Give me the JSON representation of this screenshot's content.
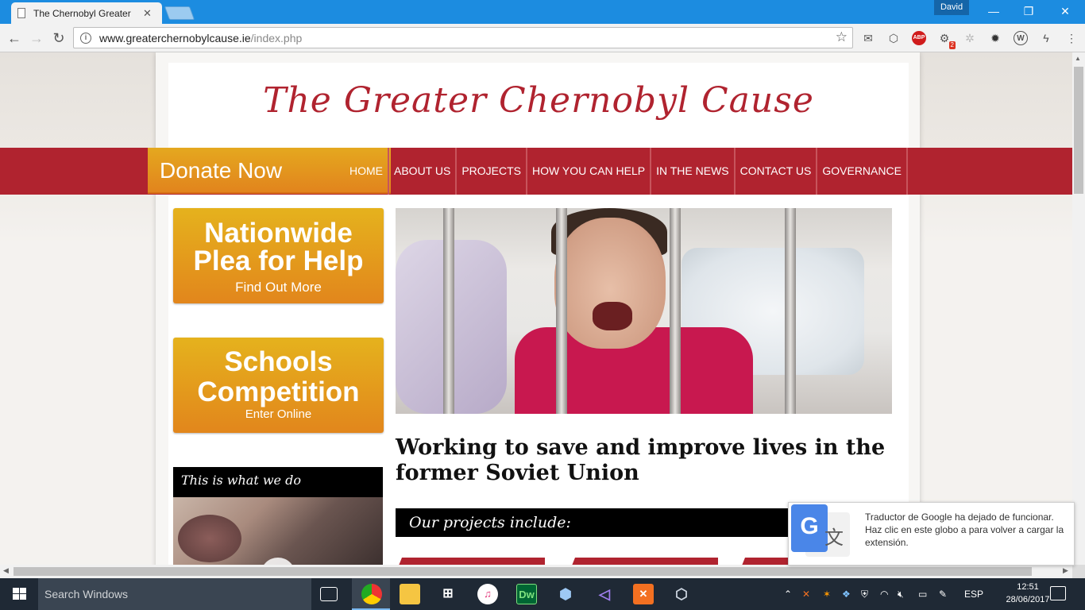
{
  "browser": {
    "tab_title": "The Chernobyl Greater C",
    "tab_close": "✕",
    "user": "David",
    "url_host": "www.greaterchernobylcause.ie",
    "url_path": "/index.php",
    "win_minimize": "—",
    "win_restore": "❐",
    "win_close": "✕",
    "extensions": [
      "mail-icon",
      "box-icon",
      "abp-icon",
      "puzzle-icon",
      "gear-icon",
      "settings-icon",
      "w-icon",
      "bolt-icon",
      "menu-icon"
    ],
    "abp_label": "ABP",
    "ext_badge": "2",
    "w_label": "W"
  },
  "site": {
    "title": "The Greater Chernobyl Cause",
    "donate": "Donate Now",
    "nav": [
      "HOME",
      "ABOUT US",
      "PROJECTS",
      "HOW YOU CAN HELP",
      "IN THE NEWS",
      "CONTACT US",
      "GOVERNANCE"
    ],
    "promo1": {
      "title": "Nationwide Plea for Help",
      "sub": "Find Out More"
    },
    "promo2": {
      "title": "Schools Competition",
      "sub": "Enter Online"
    },
    "video_title": "This is what we do",
    "tagline": "Working to save and improve lives in the former Soviet Union",
    "projects_heading": "Our projects include:"
  },
  "notification": {
    "message": "Traductor de Google ha dejado de funcionar. Haz clic en este globo a para volver a cargar la extensión.",
    "icon_letter": "G",
    "icon_glyph": "文"
  },
  "taskbar": {
    "search_placeholder": "Search Windows",
    "apps": [
      "task-view-icon",
      "chrome-icon",
      "file-explorer-icon",
      "store-icon",
      "itunes-icon",
      "dreamweaver-icon",
      "virtualbox-icon",
      "visual-studio-icon",
      "xampp-icon",
      "box3d-icon"
    ],
    "dw_label": "Dw",
    "language": "ESP",
    "time": "12:51",
    "date": "28/06/2017"
  },
  "colors": {
    "brand_red": "#b0232f",
    "donate_orange": "#e2941d",
    "taskbar": "#1f2935",
    "chrome_blue": "#1c8ce0"
  }
}
